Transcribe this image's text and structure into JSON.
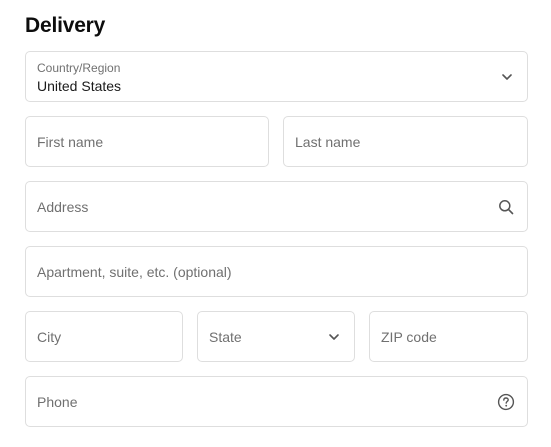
{
  "section": {
    "title": "Delivery"
  },
  "country": {
    "label": "Country/Region",
    "value": "United States",
    "icon": "chevron-down-icon"
  },
  "first_name": {
    "placeholder": "First name"
  },
  "last_name": {
    "placeholder": "Last name"
  },
  "address": {
    "placeholder": "Address",
    "icon": "search-icon"
  },
  "apartment": {
    "placeholder": "Apartment, suite, etc. (optional)"
  },
  "city": {
    "placeholder": "City"
  },
  "state": {
    "placeholder": "State",
    "icon": "chevron-down-icon"
  },
  "zip": {
    "placeholder": "ZIP code"
  },
  "phone": {
    "placeholder": "Phone",
    "icon": "help-circle-icon"
  },
  "colors": {
    "border": "#dedede",
    "placeholder": "#707070",
    "text": "#1a1a1a",
    "icon": "#555555"
  }
}
